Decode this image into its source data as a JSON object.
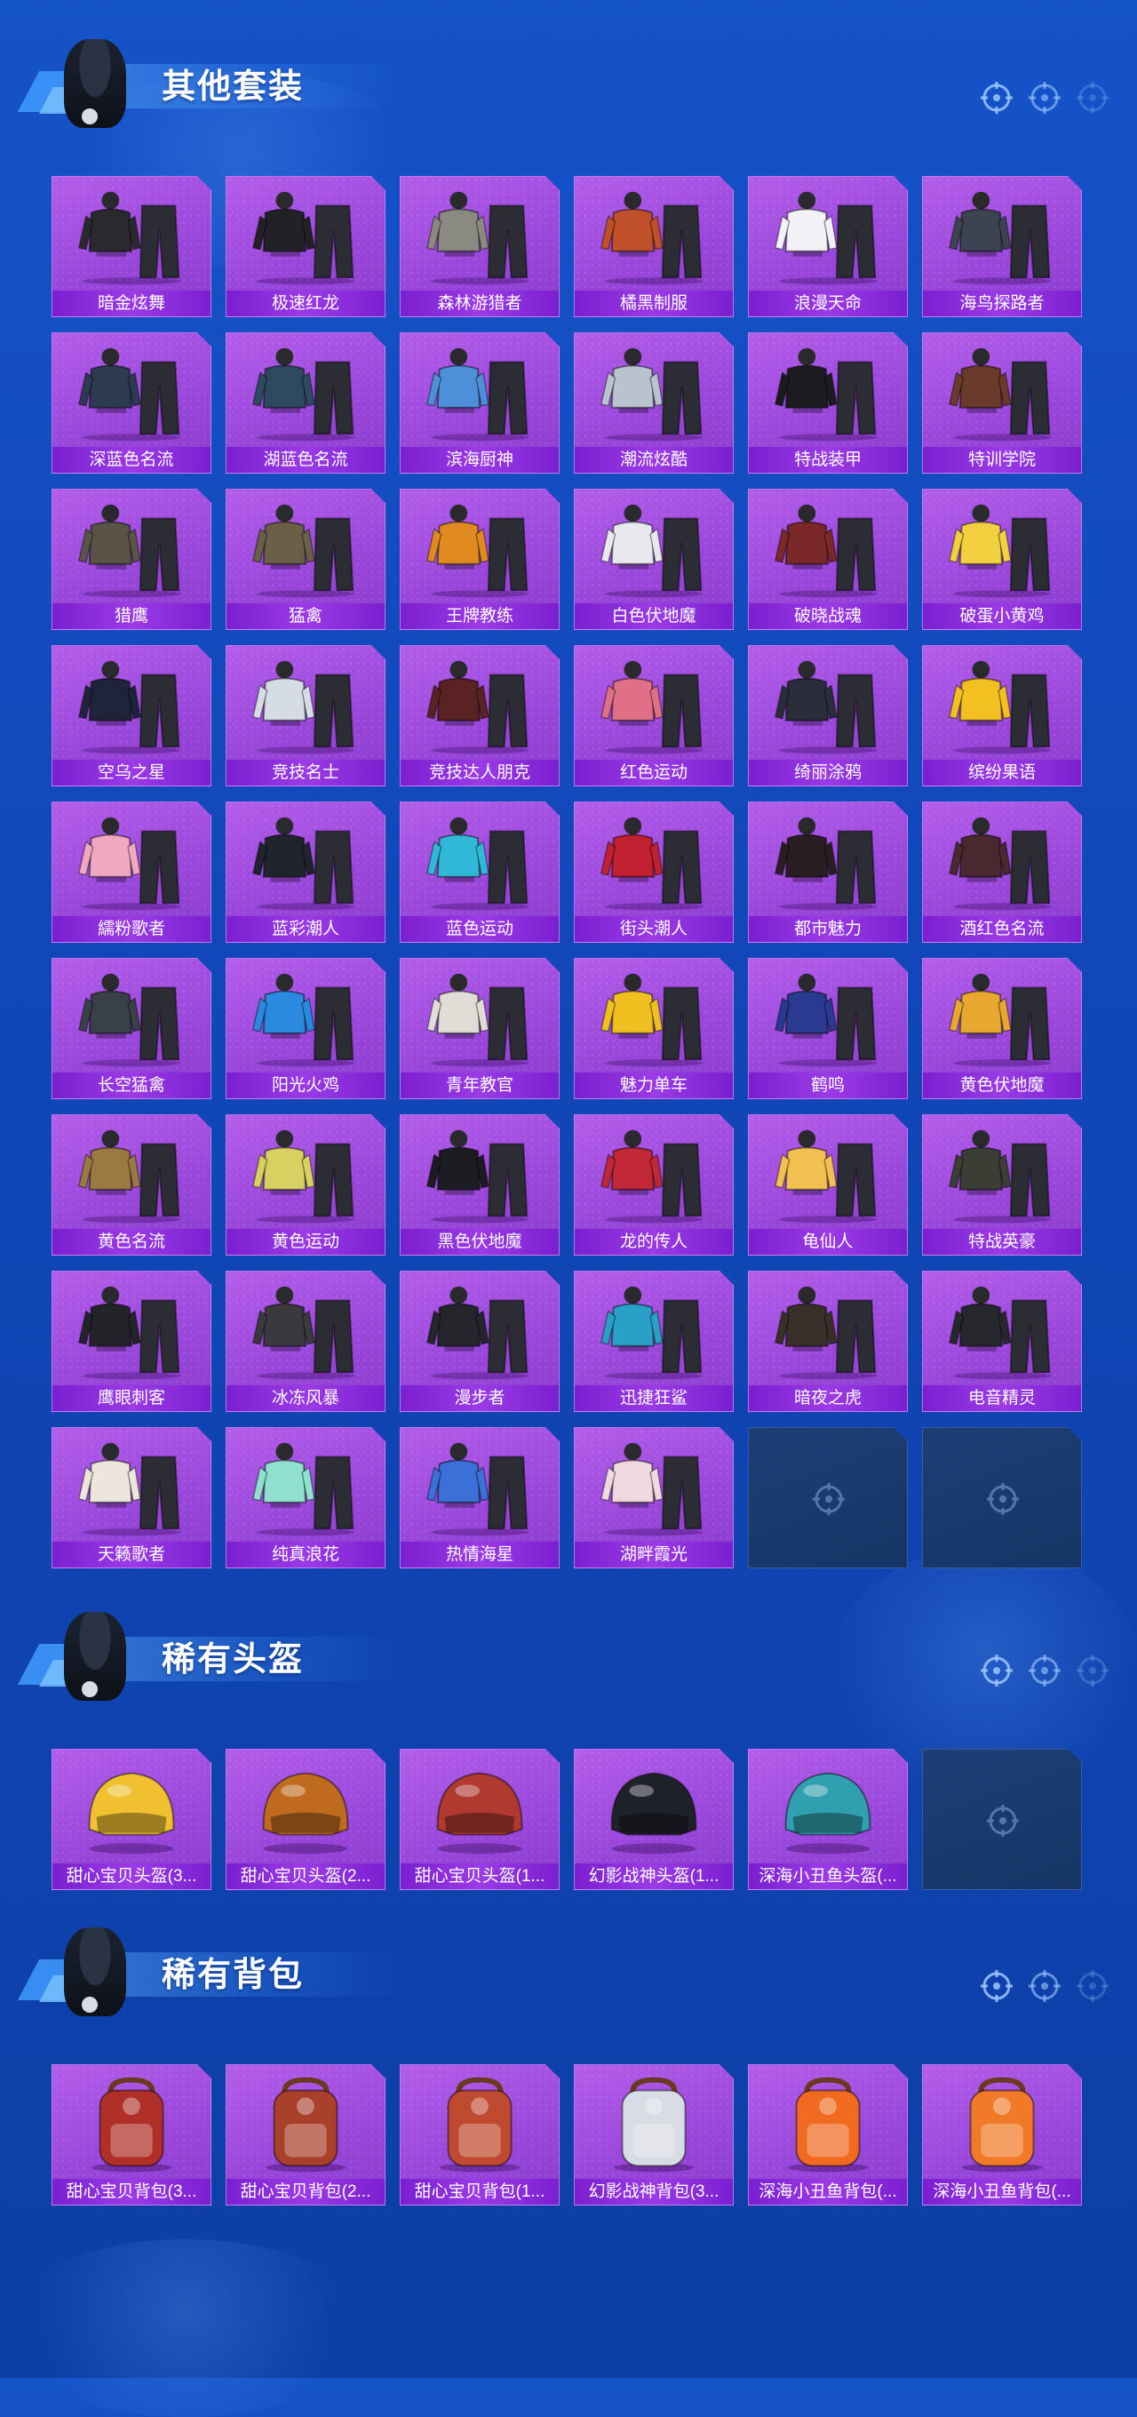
{
  "colors": {
    "background": "#1553c9",
    "tile_purple": "#a14fe2",
    "label_purple": "#8a2de0",
    "empty_tile": "#1c3f76",
    "title_text": "#ffffff"
  },
  "sections": [
    {
      "title": "其他套装",
      "items": [
        {
          "label": "暗金炫舞",
          "kind": "suit",
          "tone": "#2a2a2e"
        },
        {
          "label": "极速红龙",
          "kind": "suit",
          "tone": "#222226"
        },
        {
          "label": "森林游猎者",
          "kind": "suit",
          "tone": "#8a8a80"
        },
        {
          "label": "橘黑制服",
          "kind": "suit",
          "tone": "#c0502a"
        },
        {
          "label": "浪漫天命",
          "kind": "suit",
          "tone": "#f2f2f6"
        },
        {
          "label": "海鸟探路者",
          "kind": "suit",
          "tone": "#3c4452"
        },
        {
          "label": "深蓝色名流",
          "kind": "suit",
          "tone": "#2c3a52"
        },
        {
          "label": "湖蓝色名流",
          "kind": "suit",
          "tone": "#2e4a60"
        },
        {
          "label": "滨海厨神",
          "kind": "suit",
          "tone": "#4d8fd8"
        },
        {
          "label": "潮流炫酷",
          "kind": "suit",
          "tone": "#b9c3d0"
        },
        {
          "label": "特战装甲",
          "kind": "suit",
          "tone": "#1c1c20"
        },
        {
          "label": "特训学院",
          "kind": "suit",
          "tone": "#6a3a2a"
        },
        {
          "label": "猎鹰",
          "kind": "suit",
          "tone": "#5a5448"
        },
        {
          "label": "猛禽",
          "kind": "suit",
          "tone": "#6a6048"
        },
        {
          "label": "王牌教练",
          "kind": "suit",
          "tone": "#e08a20"
        },
        {
          "label": "白色伏地魔",
          "kind": "suit",
          "tone": "#e8e8ee"
        },
        {
          "label": "破晓战魂",
          "kind": "suit",
          "tone": "#7a2828"
        },
        {
          "label": "破蛋小黄鸡",
          "kind": "suit",
          "tone": "#f2d040"
        },
        {
          "label": "空乌之星",
          "kind": "suit",
          "tone": "#20243a"
        },
        {
          "label": "竞技名士",
          "kind": "suit",
          "tone": "#d6dce6"
        },
        {
          "label": "竞技达人朋克",
          "kind": "suit",
          "tone": "#5a2222"
        },
        {
          "label": "红色运动",
          "kind": "suit",
          "tone": "#e07088"
        },
        {
          "label": "绮丽涂鸦",
          "kind": "suit",
          "tone": "#2a2e3a"
        },
        {
          "label": "缤纷果语",
          "kind": "suit",
          "tone": "#f2c020"
        },
        {
          "label": "繻粉歌者",
          "kind": "suit",
          "tone": "#f0a8c0"
        },
        {
          "label": "蓝彩潮人",
          "kind": "suit",
          "tone": "#20242c"
        },
        {
          "label": "蓝色运动",
          "kind": "suit",
          "tone": "#30b8d8"
        },
        {
          "label": "街头潮人",
          "kind": "suit",
          "tone": "#c02030"
        },
        {
          "label": "都市魅力",
          "kind": "suit",
          "tone": "#2a1e22"
        },
        {
          "label": "酒红色名流",
          "kind": "suit",
          "tone": "#4a2830"
        },
        {
          "label": "长空猛禽",
          "kind": "suit",
          "tone": "#3a4048"
        },
        {
          "label": "阳光火鸡",
          "kind": "suit",
          "tone": "#2a8ae0"
        },
        {
          "label": "青年教官",
          "kind": "suit",
          "tone": "#e0ddd6"
        },
        {
          "label": "魅力单车",
          "kind": "suit",
          "tone": "#f0c020"
        },
        {
          "label": "鹤鸣",
          "kind": "suit",
          "tone": "#2a3a90"
        },
        {
          "label": "黄色伏地魔",
          "kind": "suit",
          "tone": "#e8a830"
        },
        {
          "label": "黄色名流",
          "kind": "suit",
          "tone": "#9a7a40"
        },
        {
          "label": "黄色运动",
          "kind": "suit",
          "tone": "#d8d060"
        },
        {
          "label": "黑色伏地魔",
          "kind": "suit",
          "tone": "#1c1c22"
        },
        {
          "label": "龙的传人",
          "kind": "suit",
          "tone": "#c02838"
        },
        {
          "label": "龟仙人",
          "kind": "suit",
          "tone": "#f2c050"
        },
        {
          "label": "特战英豪",
          "kind": "suit",
          "tone": "#3a3e34"
        },
        {
          "label": "鹰眼刺客",
          "kind": "suit",
          "tone": "#22242a"
        },
        {
          "label": "冰冻风暴",
          "kind": "suit",
          "tone": "#3a3a3e"
        },
        {
          "label": "漫步者",
          "kind": "suit",
          "tone": "#24262c"
        },
        {
          "label": "迅捷狂鲨",
          "kind": "suit",
          "tone": "#2aa0c8"
        },
        {
          "label": "暗夜之虎",
          "kind": "suit",
          "tone": "#3a302a"
        },
        {
          "label": "电音精灵",
          "kind": "suit",
          "tone": "#26282e"
        },
        {
          "label": "天籁歌者",
          "kind": "suit",
          "tone": "#ece6dc"
        },
        {
          "label": "纯真浪花",
          "kind": "suit",
          "tone": "#90e0d0"
        },
        {
          "label": "热情海星",
          "kind": "suit",
          "tone": "#3a70d8"
        },
        {
          "label": "湖畔霞光",
          "kind": "suit",
          "tone": "#f0d8e0"
        }
      ],
      "empty_slots": 2
    },
    {
      "title": "稀有头盔",
      "items": [
        {
          "label": "甜心宝贝头盔(3...",
          "kind": "helmet",
          "tone": "#f0c030"
        },
        {
          "label": "甜心宝贝头盔(2...",
          "kind": "helmet",
          "tone": "#c06a20"
        },
        {
          "label": "甜心宝贝头盔(1...",
          "kind": "helmet",
          "tone": "#b03a30"
        },
        {
          "label": "幻影战神头盔(1...",
          "kind": "helmet",
          "tone": "#20222a"
        },
        {
          "label": "深海小丑鱼头盔(...",
          "kind": "helmet",
          "tone": "#30a0b0"
        }
      ],
      "empty_slots": 1
    },
    {
      "title": "稀有背包",
      "items": [
        {
          "label": "甜心宝贝背包(3...",
          "kind": "backpack",
          "tone": "#b03028"
        },
        {
          "label": "甜心宝贝背包(2...",
          "kind": "backpack",
          "tone": "#a8402a"
        },
        {
          "label": "甜心宝贝背包(1...",
          "kind": "backpack",
          "tone": "#c04a30"
        },
        {
          "label": "幻影战神背包(3...",
          "kind": "backpack",
          "tone": "#d8dce4"
        },
        {
          "label": "深海小丑鱼背包(...",
          "kind": "backpack",
          "tone": "#f06a20"
        },
        {
          "label": "深海小丑鱼背包(...",
          "kind": "backpack",
          "tone": "#f07a28"
        }
      ],
      "empty_slots": 0
    }
  ]
}
